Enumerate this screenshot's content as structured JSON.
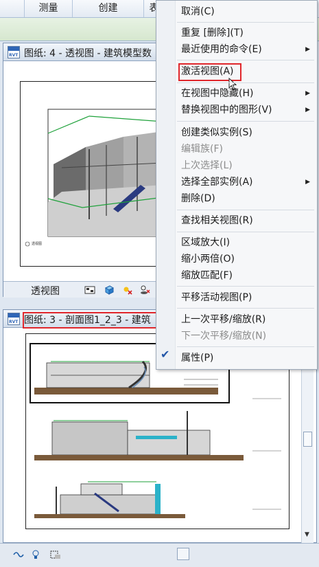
{
  "ribbon": {
    "tabs": [
      {
        "label": ""
      },
      {
        "label": "测量"
      },
      {
        "label": "创建"
      },
      {
        "label": "表"
      }
    ]
  },
  "view1": {
    "title": "图纸: 4 - 透视图 - 建筑模型数",
    "viewbar_label": "透视图",
    "sheet_note": "透视图"
  },
  "view2": {
    "title": "图纸: 3 - 剖面图1_2_3 - 建筑"
  },
  "menu": {
    "cancel": "取消(C)",
    "repeat": "重复 [删除](T)",
    "recent": "最近使用的命令(E)",
    "activate": "激活视图(A)",
    "hide_in_view": "在视图中隐藏(H)",
    "override_graphics": "替换视图中的图形(V)",
    "create_similar": "创建类似实例(S)",
    "edit_family": "编辑族(F)",
    "prev_selection": "上次选择(L)",
    "select_all": "选择全部实例(A)",
    "delete": "删除(D)",
    "find_views": "查找相关视图(R)",
    "zoom_region": "区域放大(I)",
    "zoom_out_2x": "缩小两倍(O)",
    "zoom_fit": "缩放匹配(F)",
    "pan_active": "平移活动视图(P)",
    "prev_pan_zoom": "上一次平移/缩放(R)",
    "next_pan_zoom": "下一次平移/缩放(N)",
    "properties": "属性(P)"
  },
  "icons": {
    "title_icon": "revit-sheet-icon",
    "submenu": "submenu-arrow-icon",
    "check": "check-icon"
  },
  "colors": {
    "highlight": "#e0262b",
    "ribbon_green": "#d6e7cf",
    "title_blue": "#d3deeb"
  }
}
